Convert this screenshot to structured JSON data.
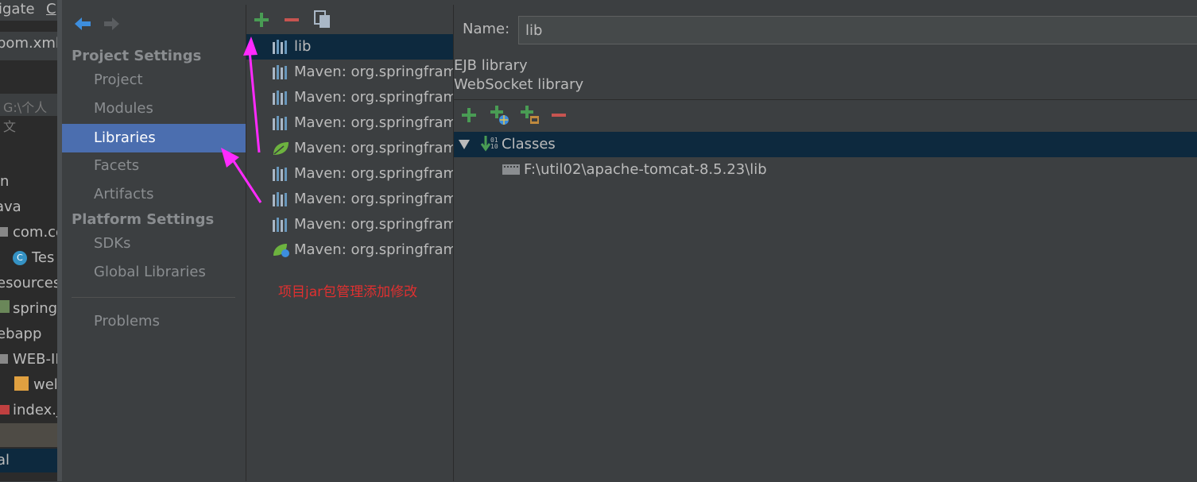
{
  "background_editor": {
    "menu_items": [
      "igate",
      "C"
    ],
    "tab_label": "pom.xml",
    "path_fragment": "G:\\个人文",
    "tree_rows": [
      {
        "label": "n",
        "icon": "none"
      },
      {
        "label": "ava",
        "icon": "none"
      },
      {
        "label": "com.co",
        "icon": "package-icon"
      },
      {
        "label": "Tes",
        "icon": "class-icon"
      },
      {
        "label": "esources",
        "icon": "none"
      },
      {
        "label": "spring",
        "icon": "spring-xml-icon"
      },
      {
        "label": "ebapp",
        "icon": "none"
      },
      {
        "label": "WEB-II",
        "icon": "folder-icon"
      },
      {
        "label": "wel",
        "icon": "xml-icon"
      },
      {
        "label": "index.j",
        "icon": "jsp-icon"
      }
    ],
    "bottom_label": "al"
  },
  "nav": {
    "project_settings_header": "Project Settings",
    "project_items": [
      "Project",
      "Modules",
      "Libraries",
      "Facets",
      "Artifacts"
    ],
    "platform_settings_header": "Platform Settings",
    "platform_items": [
      "SDKs",
      "Global Libraries"
    ],
    "problems": "Problems",
    "selected": "Libraries"
  },
  "libraries": {
    "toolbar": [
      "add-icon",
      "remove-icon",
      "copy-icon"
    ],
    "items": [
      {
        "label": "lib",
        "icon": "library-icon",
        "selected": true
      },
      {
        "label": "Maven: org.springframe",
        "icon": "library-icon"
      },
      {
        "label": "Maven: org.springframe",
        "icon": "library-icon"
      },
      {
        "label": "Maven: org.springframe",
        "icon": "library-icon"
      },
      {
        "label": "Maven: org.springframe",
        "icon": "spring-leaf-icon"
      },
      {
        "label": "Maven: org.springframe",
        "icon": "library-icon"
      },
      {
        "label": "Maven: org.springframe",
        "icon": "library-icon"
      },
      {
        "label": "Maven: org.springframe",
        "icon": "library-icon"
      },
      {
        "label": "Maven: org.springframe",
        "icon": "spring-web-icon"
      }
    ],
    "annotation": "项目jar包管理添加修改"
  },
  "detail": {
    "name_label": "Name:",
    "name_value": "lib",
    "kinds": [
      "EJB library",
      "WebSocket library"
    ],
    "toolbar": [
      "add-icon",
      "add-web-icon",
      "add-jar-icon",
      "remove-icon"
    ],
    "tree": {
      "root": "Classes",
      "children": [
        "F:\\util02\\apache-tomcat-8.5.23\\lib"
      ]
    }
  },
  "colors": {
    "selection": "#4b6eaf",
    "tree_selection": "#0d293e",
    "annotation_arrow": "#ff2aff",
    "annotation_text": "#e03030"
  }
}
